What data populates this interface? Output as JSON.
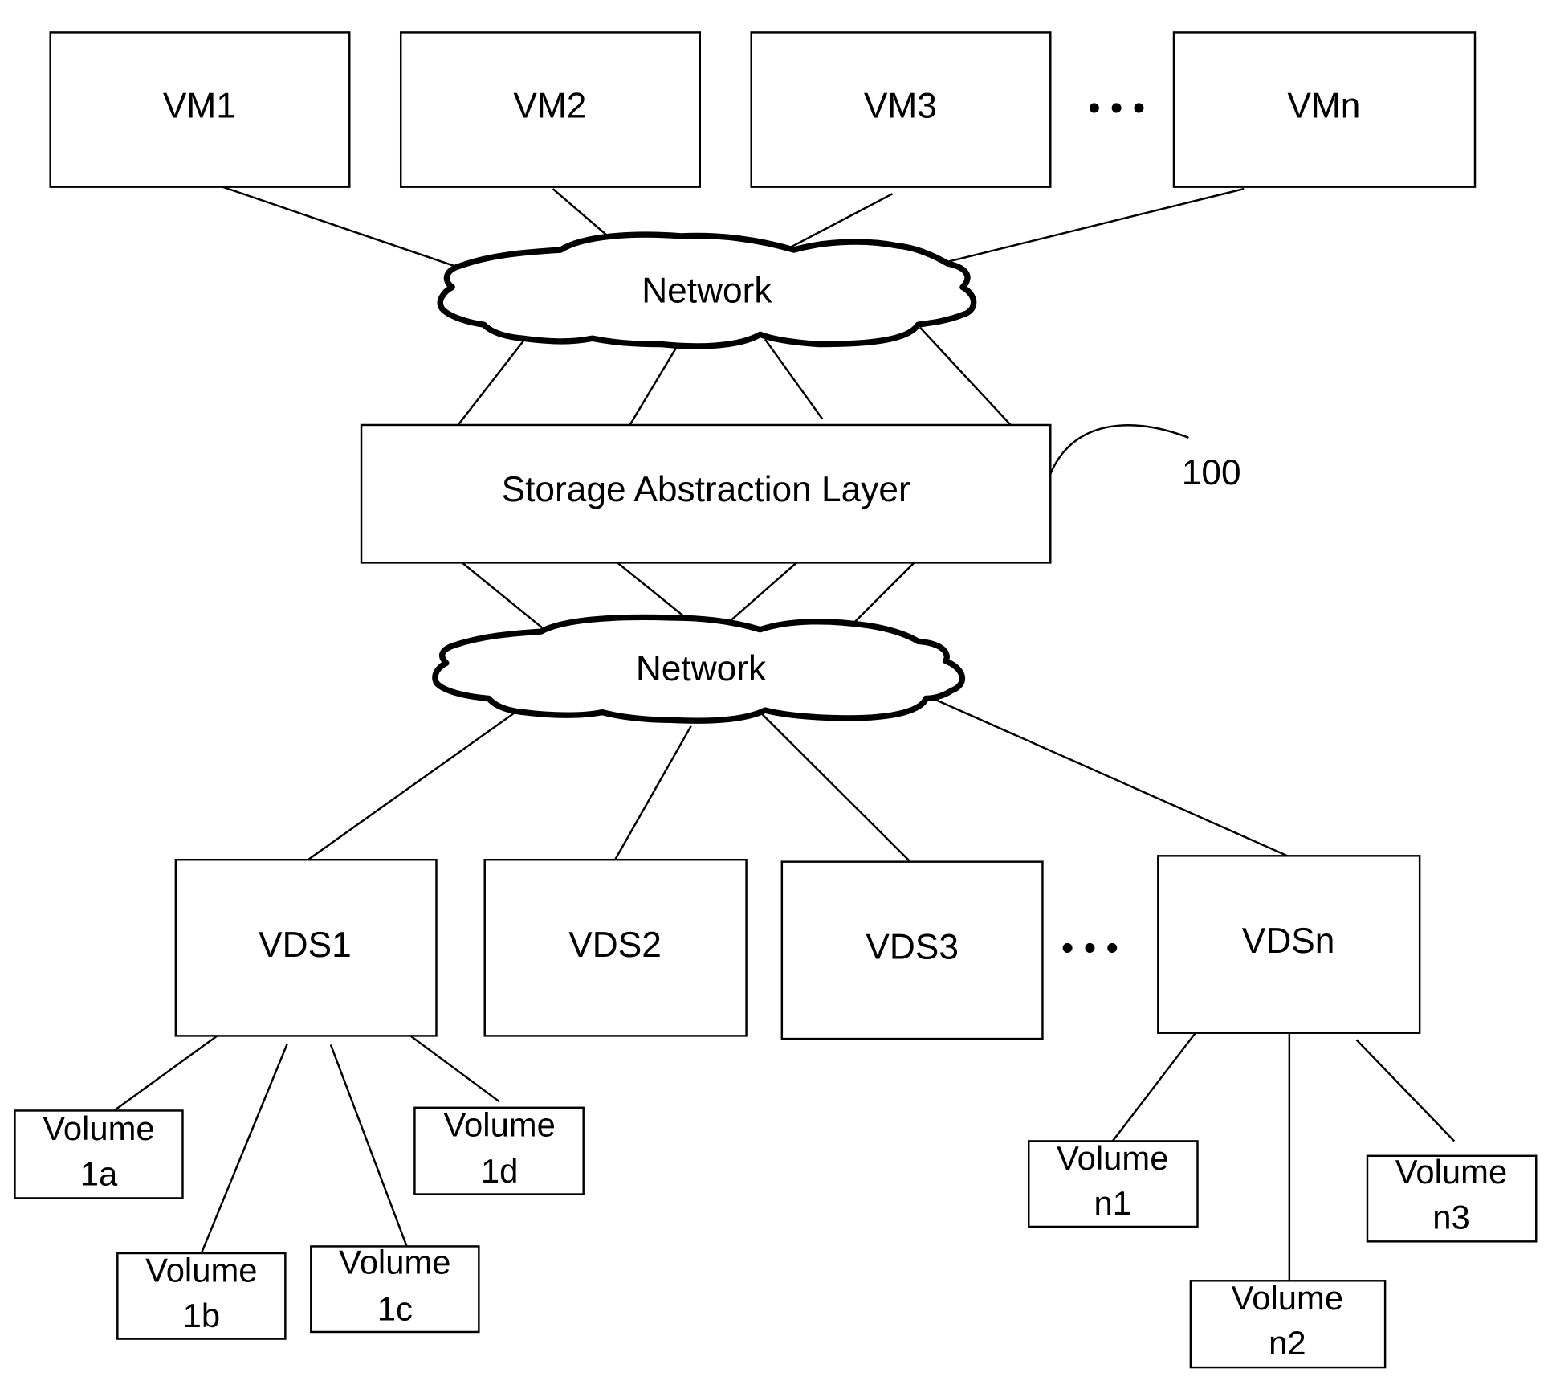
{
  "diagram": {
    "reference_numeral": "100",
    "vms": [
      {
        "id": "vm1",
        "label": "VM1"
      },
      {
        "id": "vm2",
        "label": "VM2"
      },
      {
        "id": "vm3",
        "label": "VM3"
      },
      {
        "id": "vmn",
        "label": "VMn"
      }
    ],
    "upper_network": {
      "label": "Network"
    },
    "storage_abstraction_layer": {
      "label": "Storage Abstraction Layer"
    },
    "lower_network": {
      "label": "Network"
    },
    "vds": [
      {
        "id": "vds1",
        "label": "VDS1"
      },
      {
        "id": "vds2",
        "label": "VDS2"
      },
      {
        "id": "vds3",
        "label": "VDS3"
      },
      {
        "id": "vdsn",
        "label": "VDSn"
      }
    ],
    "volumes": [
      {
        "id": "vol-1a",
        "line1": "Volume",
        "line2": "1a",
        "parent": "VDS1"
      },
      {
        "id": "vol-1b",
        "line1": "Volume",
        "line2": "1b",
        "parent": "VDS1"
      },
      {
        "id": "vol-1c",
        "line1": "Volume",
        "line2": "1c",
        "parent": "VDS1"
      },
      {
        "id": "vol-1d",
        "line1": "Volume",
        "line2": "1d",
        "parent": "VDS1"
      },
      {
        "id": "vol-n1",
        "line1": "Volume",
        "line2": "n1",
        "parent": "VDSn"
      },
      {
        "id": "vol-n2",
        "line1": "Volume",
        "line2": "n2",
        "parent": "VDSn"
      },
      {
        "id": "vol-n3",
        "line1": "Volume",
        "line2": "n3",
        "parent": "VDSn"
      }
    ],
    "ellipsis": "• • •"
  }
}
